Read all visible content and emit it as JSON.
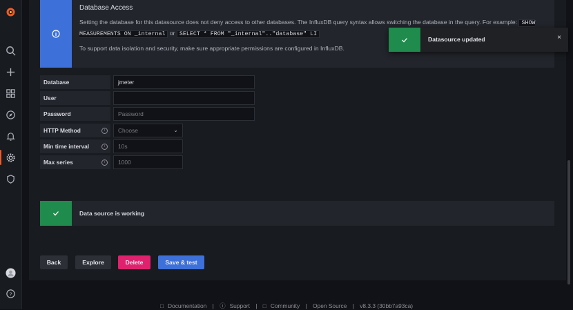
{
  "info": {
    "title": "Database Access",
    "text1": "Setting the database for this datasource does not deny access to other databases. The InfluxDB query syntax allows switching the database in the query. For",
    "example_prefix": "example:",
    "code1": "SHOW MEASUREMENTS ON _internal",
    "or": "or",
    "code2": "SELECT * FROM \"_internal\"..\"database\" LI",
    "text2": "To support data isolation and security, make sure appropriate permissions are configured in InfluxDB."
  },
  "form": {
    "database": {
      "label": "Database",
      "value": "jmeter"
    },
    "user": {
      "label": "User",
      "value": ""
    },
    "password": {
      "label": "Password",
      "placeholder": "Password"
    },
    "http_method": {
      "label": "HTTP Method",
      "value": "Choose"
    },
    "min_interval": {
      "label": "Min time interval",
      "placeholder": "10s"
    },
    "max_series": {
      "label": "Max series",
      "placeholder": "1000"
    }
  },
  "alert": {
    "text": "Data source is working"
  },
  "buttons": {
    "back": "Back",
    "explore": "Explore",
    "delete": "Delete",
    "save": "Save & test"
  },
  "toast": {
    "text": "Datasource updated",
    "close": "×"
  },
  "footer": {
    "documentation": "Documentation",
    "support": "Support",
    "community": "Community",
    "open_source": "Open Source",
    "version": "v8.3.3 (30bb7a93ca)",
    "sep": "|"
  },
  "colors": {
    "accent": "#3d71d9",
    "success": "#1f8b4c",
    "danger": "#e0226e",
    "primary": "#3d71d9"
  }
}
